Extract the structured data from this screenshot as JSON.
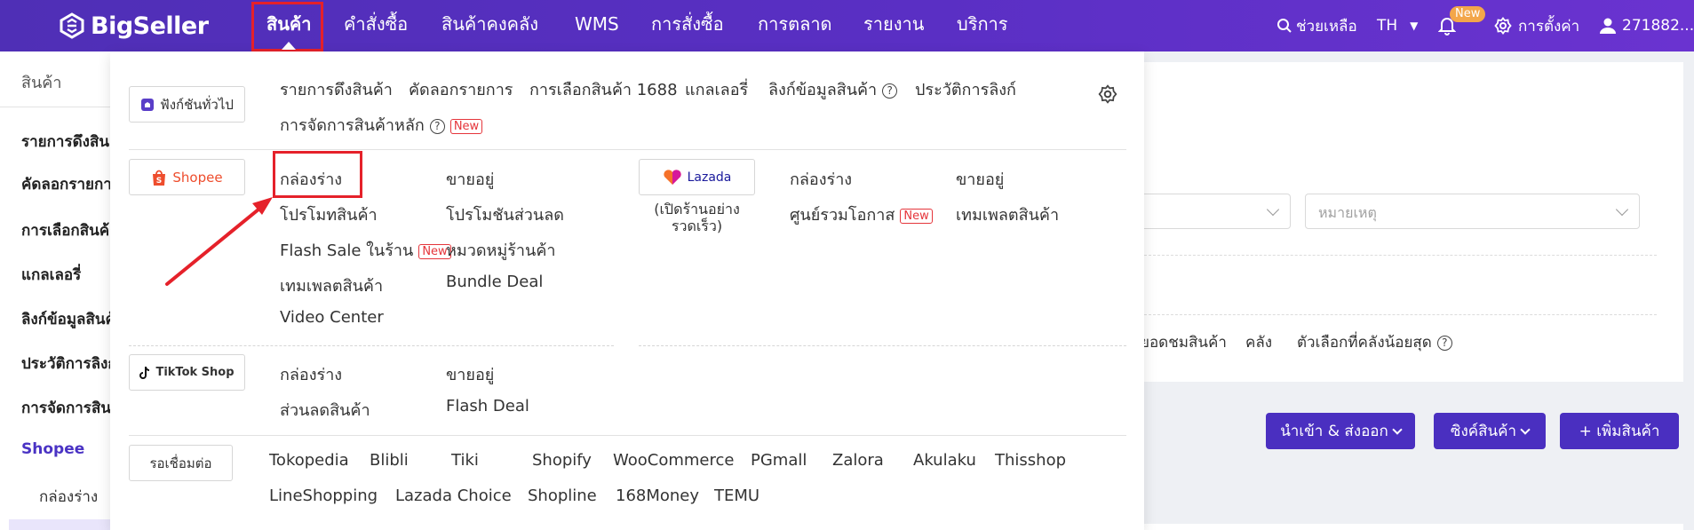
{
  "topbar": {
    "brand": "BigSeller",
    "nav": [
      {
        "label": "สินค้า",
        "active": true
      },
      {
        "label": "คำสั่งซื้อ"
      },
      {
        "label": "สินค้าคงคลัง"
      },
      {
        "label": "WMS"
      },
      {
        "label": "การสั่งซื้อ"
      },
      {
        "label": "การตลาด"
      },
      {
        "label": "รายงาน"
      },
      {
        "label": "บริการ"
      }
    ],
    "help_label": "ช่วยเหลือ",
    "language": "TH",
    "notification_badge": "New",
    "settings_label": "การตั้งค่า",
    "user_label": "271882..."
  },
  "sidebar": {
    "title": "สินค้า",
    "items": [
      "รายการดึงสินค้า",
      "คัดลอกรายการ",
      "การเลือกสินค้า",
      "แกลเลอรี่",
      "ลิงก์ข้อมูลสินค้า",
      "ประวัติการลิงก์",
      "การจัดการสินค้า",
      "Shopee"
    ],
    "sub_items": [
      "กล่องร่าง"
    ]
  },
  "background": {
    "select_placeholder": "หมายเหตุ",
    "filter_row": [
      "ยอดชมสินค้า",
      "คลัง",
      "ตัวเลือกที่คลังน้อยสุด"
    ],
    "buttons": {
      "import_export": "นำเข้า & ส่งออก",
      "sync": "ซิงค์สินค้า",
      "add": "+ เพิ่มสินค้า"
    }
  },
  "menu": {
    "general": {
      "chip": "ฟังก์ชันทั่วไป",
      "links": [
        "รายการดึงสินค้า",
        "คัดลอกรายการ",
        "การเลือกสินค้า 1688",
        "แกลเลอรี่",
        "ลิงก์ข้อมูลสินค้า",
        "ประวัติการลิงก์",
        "การจัดการสินค้าหลัก"
      ],
      "new_tag": "New"
    },
    "shopee": {
      "chip": "Shopee",
      "links": [
        "กล่องร่าง",
        "ขายอยู่",
        "โปรโมทสินค้า",
        "โปรโมชันส่วนลด",
        "Flash Sale ในร้าน",
        "หมวดหมู่ร้านค้า",
        "เทมเพลตสินค้า",
        "Bundle Deal",
        "Video Center"
      ],
      "new_tag": "New"
    },
    "lazada": {
      "chip": "Lazada",
      "note": [
        "(เปิดร้านอย่าง",
        "รวดเร็ว)"
      ],
      "links": [
        "กล่องร่าง",
        "ขายอยู่",
        "ศูนย์รวมโอกาส",
        "เทมเพลตสินค้า"
      ],
      "new_tag": "New"
    },
    "tiktok": {
      "chip": "TikTok Shop",
      "links": [
        "กล่องร่าง",
        "ขายอยู่",
        "ส่วนลดสินค้า",
        "Flash Deal"
      ]
    },
    "pending": {
      "chip": "รอเชื่อมต่อ",
      "links": [
        "Tokopedia",
        "Blibli",
        "Tiki",
        "Shopify",
        "WooCommerce",
        "PGmall",
        "Zalora",
        "Akulaku",
        "Thisshop",
        "LineShopping",
        "Lazada Choice",
        "Shopline",
        "168Money",
        "TEMU"
      ]
    }
  },
  "colors": {
    "brand_purple": "#5a2fc4",
    "highlight_red": "#e5212a",
    "shopee_orange": "#ee4d2d",
    "button_purple": "#4a2fc0"
  }
}
